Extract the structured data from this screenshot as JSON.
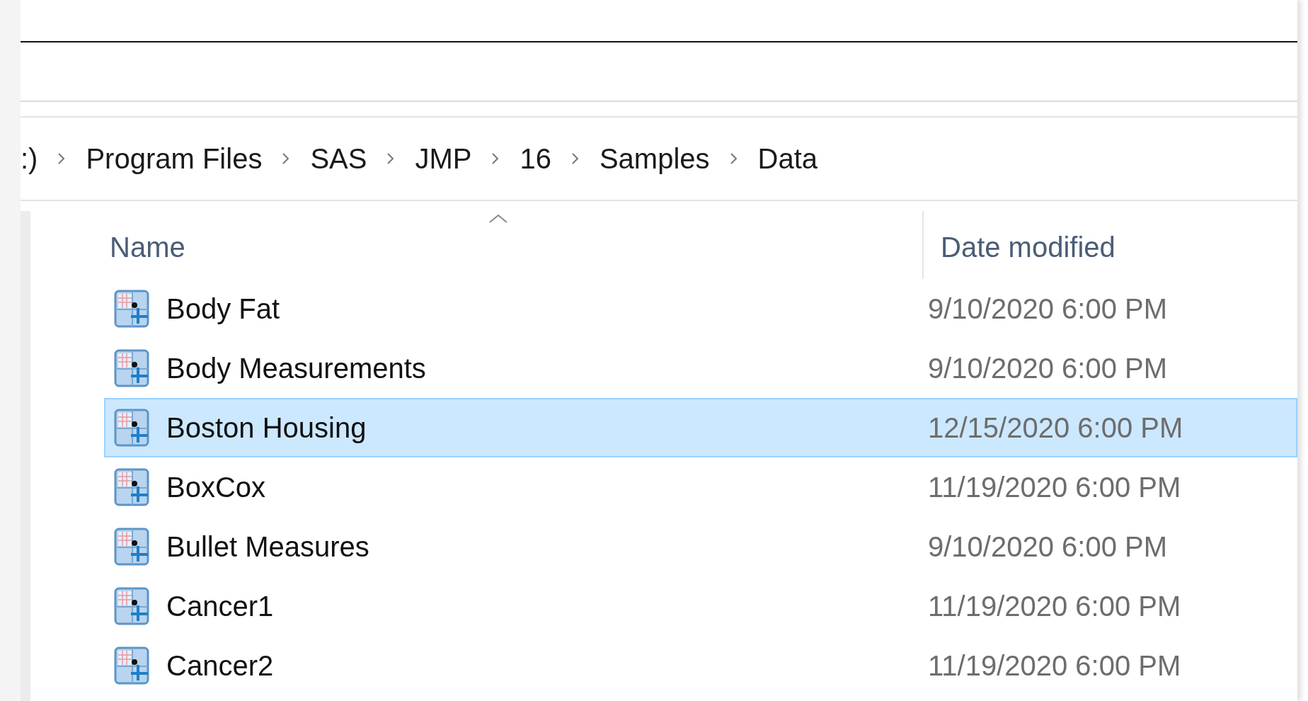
{
  "breadcrumb": [
    ":)",
    "Program Files",
    "SAS",
    "JMP",
    "16",
    "Samples",
    "Data"
  ],
  "columns": [
    {
      "label": "Name",
      "sorted": true
    },
    {
      "label": "Date modified",
      "sorted": false
    }
  ],
  "files": [
    {
      "name": "Body Fat",
      "date": "9/10/2020 6:00 PM",
      "selected": false
    },
    {
      "name": "Body Measurements",
      "date": "9/10/2020 6:00 PM",
      "selected": false
    },
    {
      "name": "Boston Housing",
      "date": "12/15/2020 6:00 PM",
      "selected": true
    },
    {
      "name": "BoxCox",
      "date": "11/19/2020 6:00 PM",
      "selected": false
    },
    {
      "name": "Bullet Measures",
      "date": "9/10/2020 6:00 PM",
      "selected": false
    },
    {
      "name": "Cancer1",
      "date": "11/19/2020 6:00 PM",
      "selected": false
    },
    {
      "name": "Cancer2",
      "date": "11/19/2020 6:00 PM",
      "selected": false
    }
  ]
}
